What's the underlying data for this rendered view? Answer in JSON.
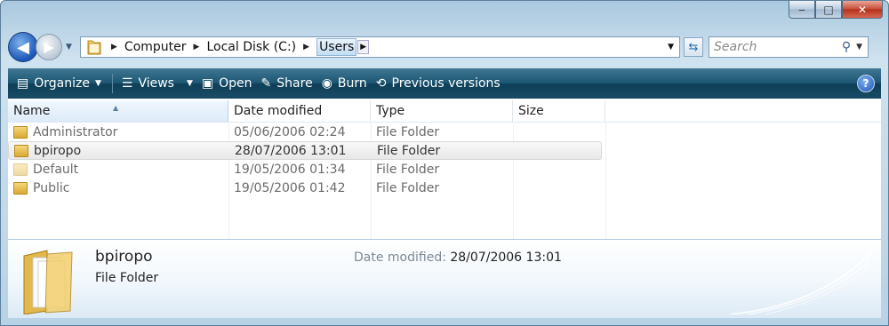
{
  "window": {
    "caption": {
      "minimize": "‒",
      "maximize": "□",
      "close": "✕"
    }
  },
  "address": {
    "crumbs": [
      "Computer",
      "Local Disk (C:)",
      "Users"
    ],
    "search_placeholder": "Search"
  },
  "toolbar": {
    "organize": "Organize",
    "views": "Views",
    "open": "Open",
    "share": "Share",
    "burn": "Burn",
    "previous_versions": "Previous versions",
    "help": "?"
  },
  "columns": {
    "name": "Name",
    "date": "Date modified",
    "type": "Type",
    "size": "Size"
  },
  "rows": [
    {
      "name": "Administrator",
      "date": "05/06/2006 02:24",
      "type": "File Folder"
    },
    {
      "name": "bpiropo",
      "date": "28/07/2006 13:01",
      "type": "File Folder"
    },
    {
      "name": "Default",
      "date": "19/05/2006 01:34",
      "type": "File Folder"
    },
    {
      "name": "Public",
      "date": "19/05/2006 01:42",
      "type": "File Folder"
    }
  ],
  "selected_index": 1,
  "details": {
    "name": "bpiropo",
    "type": "File Folder",
    "date_label": "Date modified:",
    "date_value": "28/07/2006 13:01"
  },
  "colors": {
    "toolbar": "#1d5672",
    "accent": "#2a6db3"
  }
}
